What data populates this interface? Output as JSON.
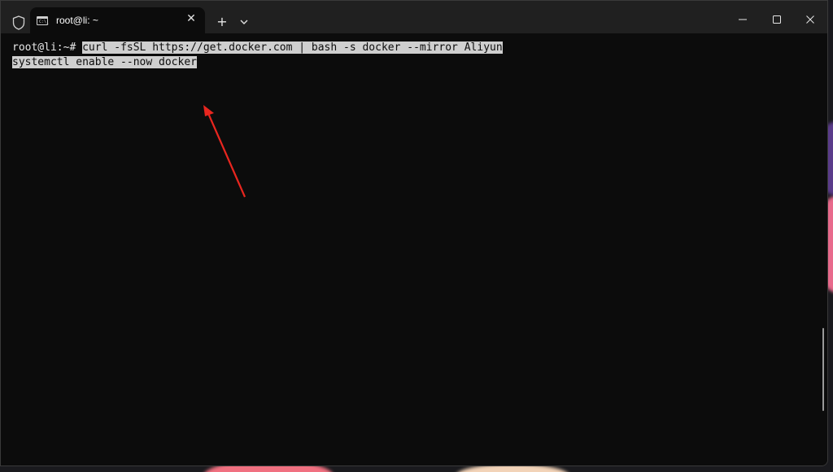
{
  "window": {
    "tab_title": "root@li: ~",
    "tab_icon_text": "C:\\_",
    "close_tab_glyph": "✕",
    "new_tab_glyph": "+"
  },
  "terminal": {
    "prompt": "root@li:~#",
    "command_line1": "curl -fsSL https://get.docker.com | bash -s docker --mirror Aliyun",
    "command_line2": "systemctl enable --now docker"
  },
  "icons": {
    "shield": "shield-icon",
    "terminal": "terminal-icon",
    "close_tab": "close-icon",
    "new_tab": "plus-icon",
    "dropdown": "chevron-down-icon",
    "minimize": "minimize-icon",
    "maximize": "maximize-icon",
    "close_window": "close-icon"
  },
  "colors": {
    "terminal_bg": "#0c0c0c",
    "titlebar_bg": "#202020",
    "selection_bg": "#cfcfcf",
    "annotation_arrow": "#e8261f"
  }
}
